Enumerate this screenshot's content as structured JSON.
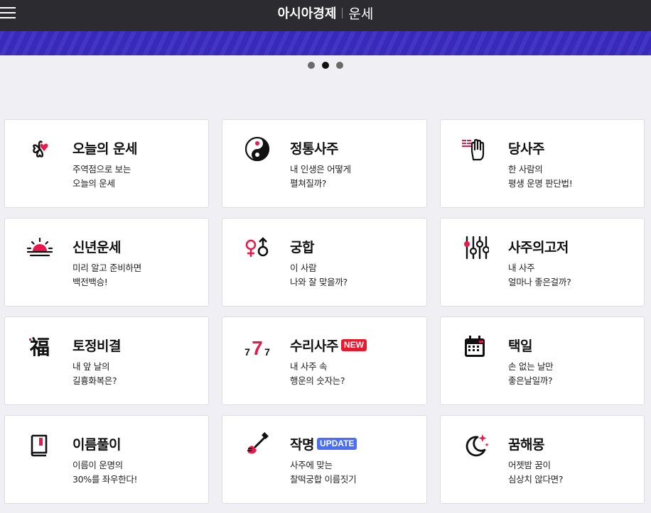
{
  "header": {
    "brand": "아시아경제",
    "section": "운세"
  },
  "carousel": {
    "dots": 3,
    "active_index": 1
  },
  "colors": {
    "accent": "#e8194a",
    "header_bg": "#2b2b30",
    "banner": "#3a2bc2",
    "new_badge": "#e8192c",
    "update_badge": "#4a6ef5"
  },
  "cards": [
    {
      "title": "오늘의 운세",
      "desc1": "주역점으로 보는",
      "desc2": "오늘의 운세",
      "icon": "clover-heart-icon"
    },
    {
      "title": "정통사주",
      "desc1": "내 인생은 어떻게",
      "desc2": "펼쳐질까?",
      "icon": "yin-yang-icon"
    },
    {
      "title": "당사주",
      "desc1": "한 사람의",
      "desc2": "평생 운명 판단법!",
      "icon": "palm-hand-icon"
    },
    {
      "title": "신년운세",
      "desc1": "미리 알고 준비하면",
      "desc2": "백전백승!",
      "icon": "sunrise-icon"
    },
    {
      "title": "궁합",
      "desc1": "이 사람",
      "desc2": "나와 잘 맞을까?",
      "icon": "gender-symbols-icon"
    },
    {
      "title": "사주의고저",
      "desc1": "내 사주",
      "desc2": "얼마나 좋은걸까?",
      "icon": "sliders-icon"
    },
    {
      "title": "토정비결",
      "desc1": "내 앞 날의",
      "desc2": "길흉화복은?",
      "icon": "fortune-character-icon",
      "icon_text": "福"
    },
    {
      "title": "수리사주",
      "desc1": "내 사주 속",
      "desc2": "행운의 숫자는?",
      "icon": "lucky-seven-icon",
      "badge": "NEW",
      "icon_digits": [
        "7",
        "7",
        "7"
      ]
    },
    {
      "title": "택일",
      "desc1": "손 없는 날만",
      "desc2": "좋은날일까?",
      "icon": "calendar-icon"
    },
    {
      "title": "이름풀이",
      "desc1": "이름이 운명의",
      "desc2": "30%를 좌우한다!",
      "icon": "book-icon"
    },
    {
      "title": "작명",
      "desc1": "사주에 맞는",
      "desc2": "찰떡궁합 이름짓기",
      "icon": "brush-icon",
      "badge": "UPDATE"
    },
    {
      "title": "꿈해몽",
      "desc1": "어젯밤 꿈이",
      "desc2": "심상치 않다면?",
      "icon": "moon-stars-icon"
    }
  ]
}
